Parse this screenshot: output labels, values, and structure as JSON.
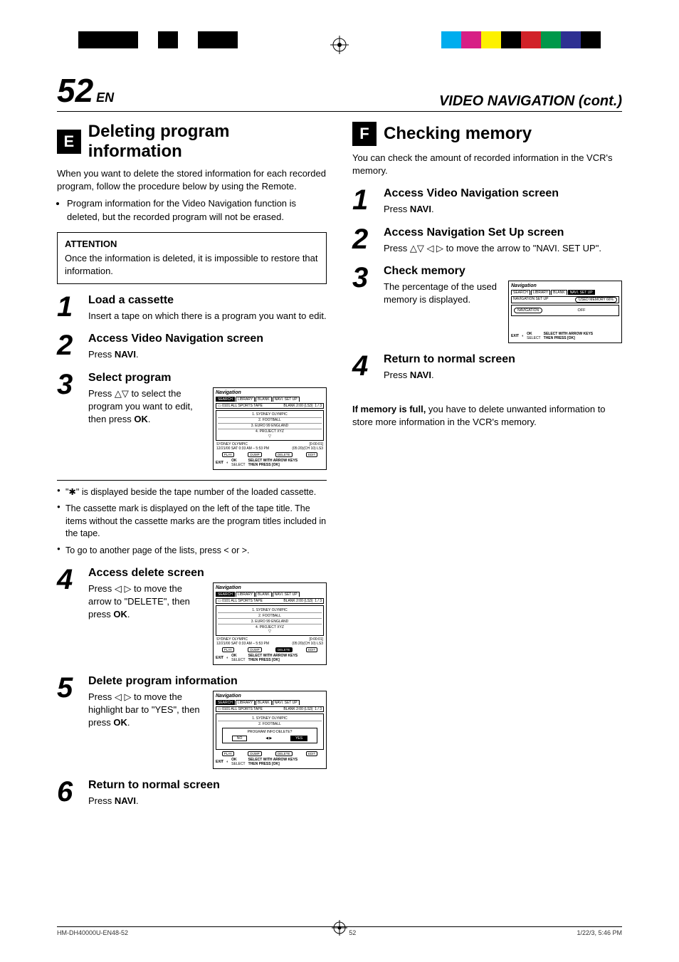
{
  "page_number": "52",
  "page_suffix": "EN",
  "chapter": "VIDEO NAVIGATION (cont.)",
  "left": {
    "letter": "E",
    "title": "Deleting program information",
    "intro": "When you want to delete the stored information for each recorded program, follow the procedure below by using the Remote.",
    "intro_bullet": "Program information for the Video Navigation function is deleted, but the recorded program will not be erased.",
    "attention_label": "ATTENTION",
    "attention_body": "Once the information is deleted, it is impossible to restore that information.",
    "steps": [
      {
        "n": "1",
        "head": "Load a cassette",
        "body": "Insert a tape on which there is a program you want to edit."
      },
      {
        "n": "2",
        "head": "Access Video Navigation screen",
        "body_prefix": "Press ",
        "body_bold": "NAVI",
        "body_suffix": "."
      },
      {
        "n": "3",
        "head": "Select program",
        "body": "Press △▽ to select the program you want to edit, then press ",
        "body_bold": "OK",
        "body_suffix": "."
      }
    ],
    "notes": [
      "\"✱\" is displayed beside the tape number of the loaded cassette.",
      "The cassette mark is displayed on the left of the tape title. The items without the cassette marks are the program titles included in the tape.",
      "To go to another page of the lists, press < or >."
    ],
    "step4": {
      "n": "4",
      "head": "Access delete screen",
      "body": "Press ◁ ▷ to move the arrow to \"DELETE\", then press ",
      "body_bold": "OK",
      "body_suffix": "."
    },
    "step5": {
      "n": "5",
      "head": "Delete program information",
      "body": "Press ◁ ▷ to move the highlight bar to \"YES\", then press ",
      "body_bold": "OK",
      "body_suffix": "."
    },
    "step6": {
      "n": "6",
      "head": "Return to normal screen",
      "body_prefix": "Press ",
      "body_bold": "NAVI",
      "body_suffix": "."
    }
  },
  "right": {
    "letter": "F",
    "title": "Checking memory",
    "intro": "You can check the amount of recorded information in the VCR's memory.",
    "steps": [
      {
        "n": "1",
        "head": "Access Video Navigation screen",
        "body_prefix": "Press ",
        "body_bold": "NAVI",
        "body_suffix": "."
      },
      {
        "n": "2",
        "head": "Access Navigation Set Up screen",
        "body": "Press △▽ ◁ ▷ to move the arrow to \"NAVI. SET UP\"."
      },
      {
        "n": "3",
        "head": "Check memory",
        "body": "The percentage of the used memory is displayed."
      },
      {
        "n": "4",
        "head": "Return to normal screen",
        "body_prefix": "Press ",
        "body_bold": "NAVI",
        "body_suffix": "."
      }
    ],
    "memnote_lead": "If memory is full,",
    "memnote_rest": " you have to delete unwanted information to store more information in the VCR's memory."
  },
  "nav": {
    "title": "Navigation",
    "tabs": [
      "SEARCH",
      "LIBRARY",
      "BLANK",
      "NAVI. SET UP"
    ],
    "tape": "0101 ALL SPORTS TAPE",
    "blank_label": "BLANK 2:00 (LS3)",
    "page": "1 / 3",
    "items": [
      "1. SYDNEY OLYMPIC",
      "2. FOOTBALL",
      "3. EURO 99 ENGLAND",
      "4. PROJECT XYZ"
    ],
    "meta_left": "SYDNEY OLYMPIC\n12/21/00 SAT 0:33 AM – 5:53 PM",
    "meta_right": "[0:00:01]\n(05:20)(CH 10) LS3",
    "buttons": [
      "PLAY",
      "DUMP",
      "DELETE",
      "EDIT"
    ],
    "exit": "EXIT",
    "ok": "OK",
    "select": "SELECT",
    "hint1": "SELECT WITH ARROW KEYS",
    "hint2": "THEN PRESS [OK]",
    "delete_q": "PROGRAM INFO DELETE?",
    "no": "NO",
    "yes": "YES",
    "setup_label": "NAVIGATION SET UP",
    "used_mem": "USED MEMORY 66%",
    "navsetting": "NAVIGATION",
    "off": "OFF"
  },
  "footer": {
    "left": "HM-DH40000U-EN48-52",
    "center": "52",
    "right": "1/22/3, 5:46 PM"
  },
  "colors": {
    "bars_left": [
      "#000",
      "#000",
      "#000",
      "#fff",
      "#000",
      "#fff",
      "#000",
      "#000"
    ],
    "bars_right": [
      "#00adee",
      "#d71f85",
      "#fdf100",
      "#000",
      "#d12229",
      "#00984a",
      "#2e3092",
      "#000"
    ]
  }
}
